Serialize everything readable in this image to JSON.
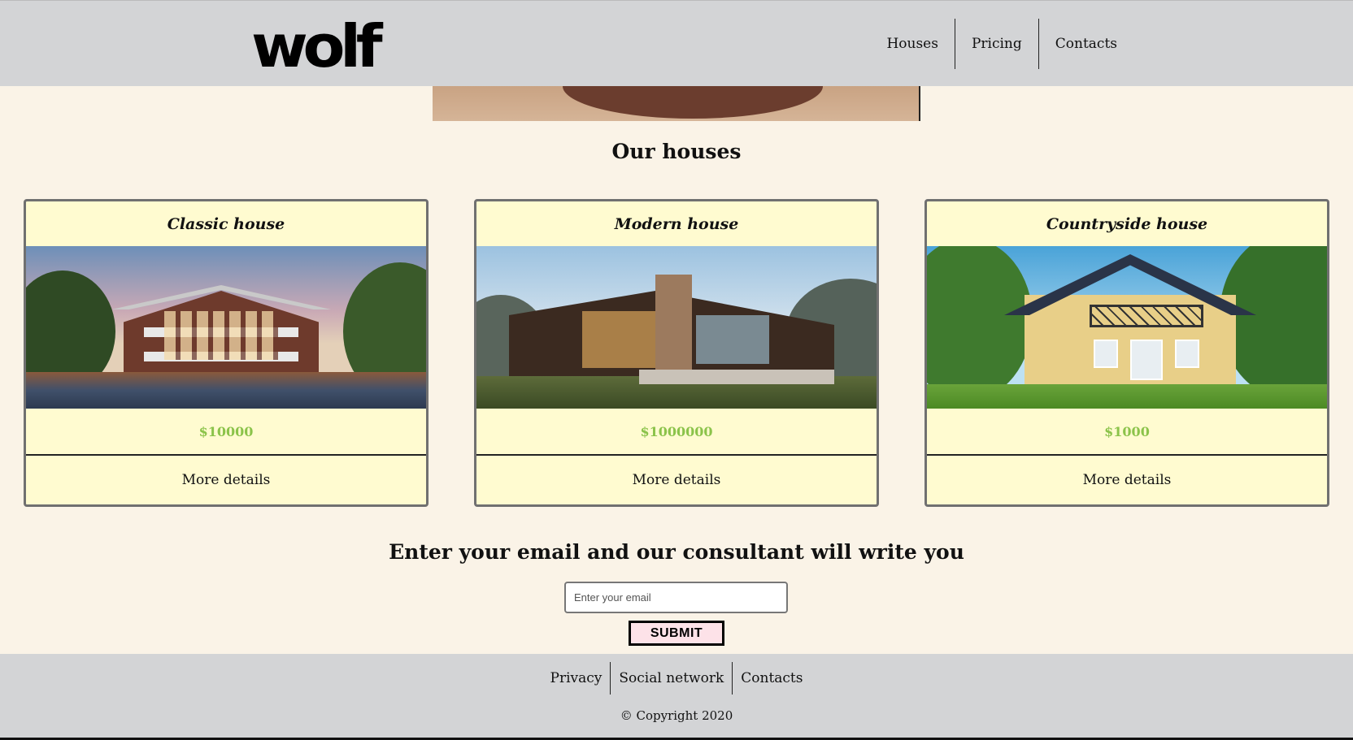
{
  "header": {
    "logo": "wolf",
    "nav": [
      {
        "label": "Houses"
      },
      {
        "label": "Pricing"
      },
      {
        "label": "Contacts"
      }
    ]
  },
  "houses": {
    "title": "Our houses",
    "cards": [
      {
        "title": "Classic house",
        "price": "$10000",
        "details": "More details"
      },
      {
        "title": "Modern house",
        "price": "$1000000",
        "details": "More details"
      },
      {
        "title": "Countryside house",
        "price": "$1000",
        "details": "More details"
      }
    ]
  },
  "subscribe": {
    "title": "Enter your email and our consultant will write you",
    "placeholder": "Enter your email",
    "submit": "SUBMIT"
  },
  "footer": {
    "links": [
      {
        "label": "Privacy"
      },
      {
        "label": "Social network"
      },
      {
        "label": "Contacts"
      }
    ],
    "copyright": "© Copyright 2020"
  },
  "colors": {
    "background": "#faf3e7",
    "header_footer": "#d3d4d6",
    "card": "#fffbd0",
    "price": "#8bc34a",
    "submit_bg": "#fde2e8"
  }
}
